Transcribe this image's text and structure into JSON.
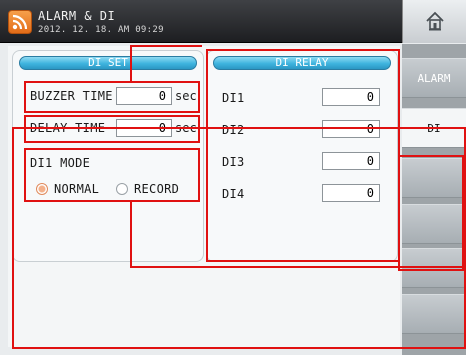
{
  "header": {
    "title": "ALARM & DI",
    "date": "2012. 12. 18. AM 09:29",
    "icons": {
      "logo": "rss-icon",
      "home": "home-icon"
    }
  },
  "di_set": {
    "heading": "DI SET",
    "buzzer_time": {
      "label": "BUZZER TIME",
      "value": "0",
      "unit": "sec"
    },
    "delay_time": {
      "label": "DELAY TIME",
      "value": "0",
      "unit": "sec"
    },
    "di1_mode": {
      "label": "DI1 MODE",
      "options": [
        "NORMAL",
        "RECORD"
      ],
      "selected": "NORMAL"
    }
  },
  "di_relay": {
    "heading": "DI RELAY",
    "rows": [
      {
        "label": "DI1",
        "value": "0"
      },
      {
        "label": "DI2",
        "value": "0"
      },
      {
        "label": "DI3",
        "value": "0"
      },
      {
        "label": "DI4",
        "value": "0"
      }
    ]
  },
  "tabs": [
    {
      "label": "ALARM",
      "active": false
    },
    {
      "label": "DI",
      "active": true
    },
    {
      "label": "",
      "active": false
    },
    {
      "label": "",
      "active": false
    },
    {
      "label": "",
      "active": false
    },
    {
      "label": "",
      "active": false
    }
  ],
  "colors": {
    "header": "#2a2b2e",
    "group_head": "#3eb4de",
    "annotation": "#e01111",
    "radio_selected": "#f3b08a"
  }
}
